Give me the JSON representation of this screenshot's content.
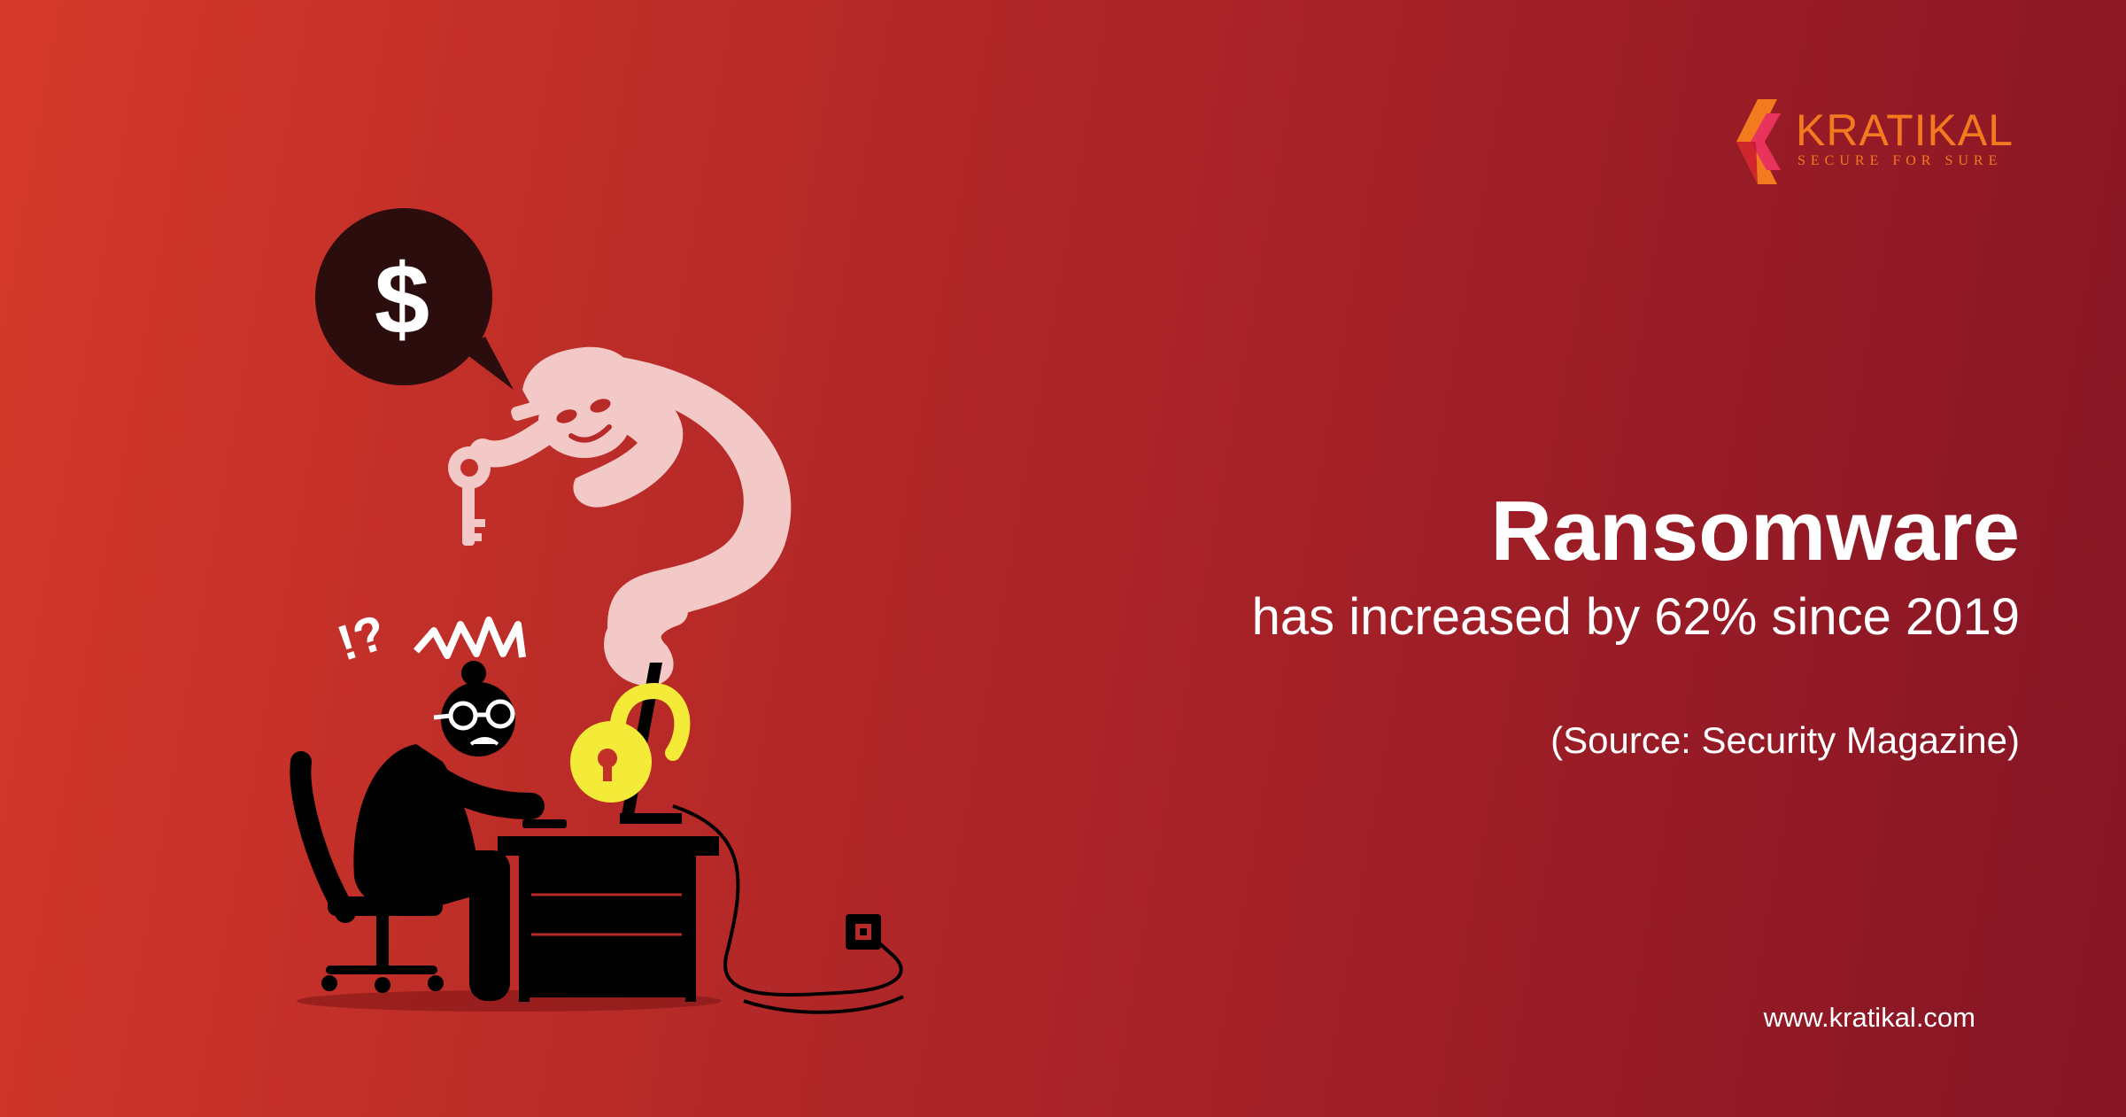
{
  "brand": {
    "name": "KRATIKAL",
    "tagline": "SECURE FOR SURE",
    "accent_color": "#f47a20"
  },
  "headline": "Ransomware",
  "subhead": "has increased by 62% since 2019",
  "source": "(Source: Security Magazine)",
  "website": "www.kratikal.com",
  "illustration": {
    "speech_bubble_symbol": "$",
    "confusion_mark": "!?",
    "icons": [
      "dollar-speech-bubble",
      "hacker-ghost",
      "key-icon",
      "padlock-icon",
      "user-at-desk",
      "computer-monitor",
      "power-socket"
    ]
  },
  "colors": {
    "background_start": "#d5392a",
    "background_end": "#851524",
    "ghost": "#f2c9c7",
    "padlock": "#f4ea38",
    "silhouette": "#000000",
    "bubble": "#2a0d0c"
  }
}
